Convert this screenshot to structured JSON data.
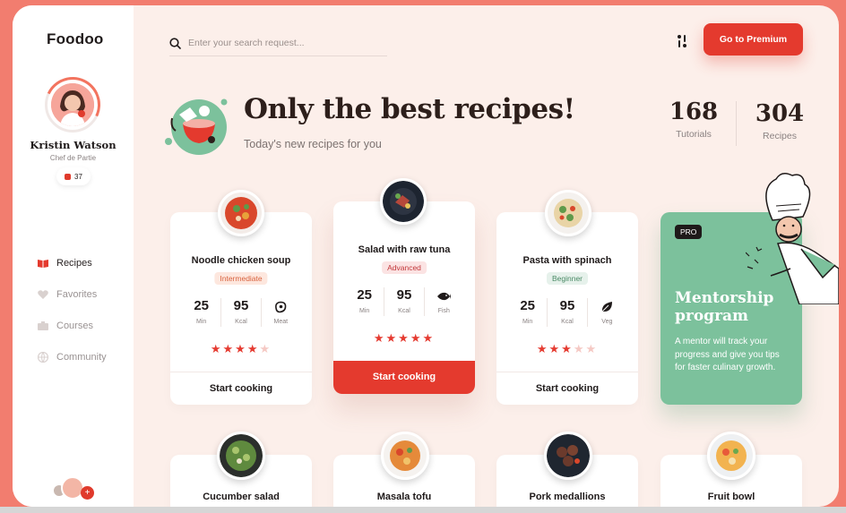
{
  "app": {
    "logo": "Foodoo"
  },
  "user": {
    "name": "Kristin Watson",
    "role": "Chef de Partie",
    "badge_count": "37"
  },
  "nav": [
    {
      "label": "Recipes",
      "icon": "book-icon",
      "active": true
    },
    {
      "label": "Favorites",
      "icon": "heart-icon",
      "active": false
    },
    {
      "label": "Courses",
      "icon": "briefcase-icon",
      "active": false
    },
    {
      "label": "Community",
      "icon": "globe-icon",
      "active": false
    }
  ],
  "header": {
    "search_placeholder": "Enter your search request...",
    "premium_label": "Go to Premium"
  },
  "hero": {
    "title": "Only the best recipes!",
    "subtitle": "Today's new recipes for you"
  },
  "stats": [
    {
      "value": "168",
      "label": "Tutorials"
    },
    {
      "value": "304",
      "label": "Recipes"
    }
  ],
  "recipes": [
    {
      "title": "Noodle chicken soup",
      "level": "Intermediate",
      "min": "25",
      "min_label": "Min",
      "kcal": "95",
      "kcal_label": "Kcal",
      "type": "Meat",
      "type_icon": "meat-icon",
      "rating": 4,
      "cta": "Start cooking"
    },
    {
      "title": "Salad with raw tuna",
      "level": "Advanced",
      "min": "25",
      "min_label": "Min",
      "kcal": "95",
      "kcal_label": "Kcal",
      "type": "Fish",
      "type_icon": "fish-icon",
      "rating": 5,
      "cta": "Start cooking"
    },
    {
      "title": "Pasta with spinach",
      "level": "Beginner",
      "min": "25",
      "min_label": "Min",
      "kcal": "95",
      "kcal_label": "Kcal",
      "type": "Veg",
      "type_icon": "leaf-icon",
      "rating": 3,
      "cta": "Start cooking"
    }
  ],
  "mentorship": {
    "badge": "PRO",
    "title_line1": "Mentorship",
    "title_line2": "program",
    "text": "A mentor will track your progress and give you tips for faster culinary growth."
  },
  "more_recipes": [
    {
      "title": "Cucumber salad"
    },
    {
      "title": "Masala tofu"
    },
    {
      "title": "Pork medallions"
    },
    {
      "title": "Fruit bowl"
    }
  ],
  "colors": {
    "accent": "#e43a2e",
    "mint": "#7cc19c",
    "background": "#fcefea",
    "outer": "#f27d6f"
  }
}
